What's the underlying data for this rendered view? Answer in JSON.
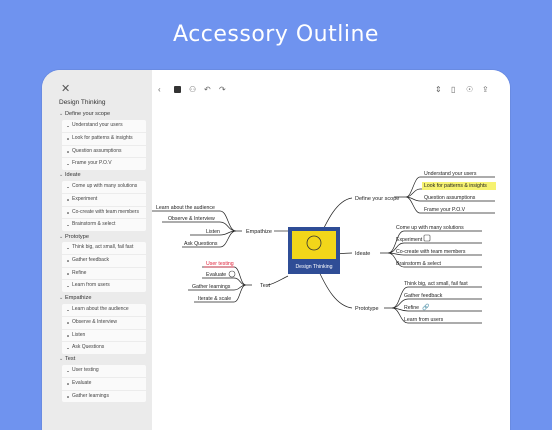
{
  "headline": "Accessory Outline",
  "sidebar": {
    "doc_title": "Design Thinking",
    "sections": [
      {
        "title": "Define your scope",
        "items": [
          "Understand your users",
          "Look for patterns & insights",
          "Question assumptions",
          "Frame your P.O.V"
        ]
      },
      {
        "title": "Ideate",
        "items": [
          "Come up with many solutions",
          "Experiment",
          "Co-create with team members",
          "Brainstorm & select"
        ]
      },
      {
        "title": "Prototype",
        "items": [
          "Think big, act small, fail fast",
          "Gather feedback",
          "Refine",
          "Learn from users"
        ]
      },
      {
        "title": "Empathize",
        "items": [
          "Learn about the audience",
          "Observe & Interview",
          "Listen",
          "Ask Questions"
        ]
      },
      {
        "title": "Test",
        "items": [
          "User testing",
          "Evaluate",
          "Gather learnings"
        ]
      }
    ]
  },
  "toolbar": {
    "back": "back-icon",
    "format": "format-icon",
    "collab": "add-collaborator-icon",
    "undo": "undo-icon",
    "redo": "redo-icon",
    "sort": "sort-icon",
    "outline": "outline-icon",
    "theme": "theme-icon",
    "share": "share-icon"
  },
  "map": {
    "central": "Design Thinking",
    "branches": {
      "define": {
        "label": "Define your scope",
        "items": [
          "Understand your users",
          "Look for patterns & insights",
          "Question assumptions",
          "Frame your P.O.V"
        ]
      },
      "ideate": {
        "label": "Ideate",
        "items": [
          "Come up with many solutions",
          "Experiment",
          "Co-create with team members",
          "Brainstorm & select"
        ]
      },
      "prototype": {
        "label": "Prototype",
        "items": [
          "Think big, act small, fail fast",
          "Gather feedback",
          "Refine",
          "Learn from users"
        ]
      },
      "empathize": {
        "label": "Empathize",
        "items": [
          "Learn about the audience",
          "Observe & Interview",
          "Listen",
          "Ask Questions"
        ]
      },
      "test": {
        "label": "Test",
        "items": [
          "User testing",
          "Evaluate",
          "Gather learnings",
          "Iterate & scale"
        ]
      }
    }
  },
  "colors": {
    "background": "#6f93ef",
    "central_box": "#2f4d96",
    "central_image": "#f2d61a",
    "highlight": "#f6f271",
    "user_testing": "#e0223a"
  }
}
